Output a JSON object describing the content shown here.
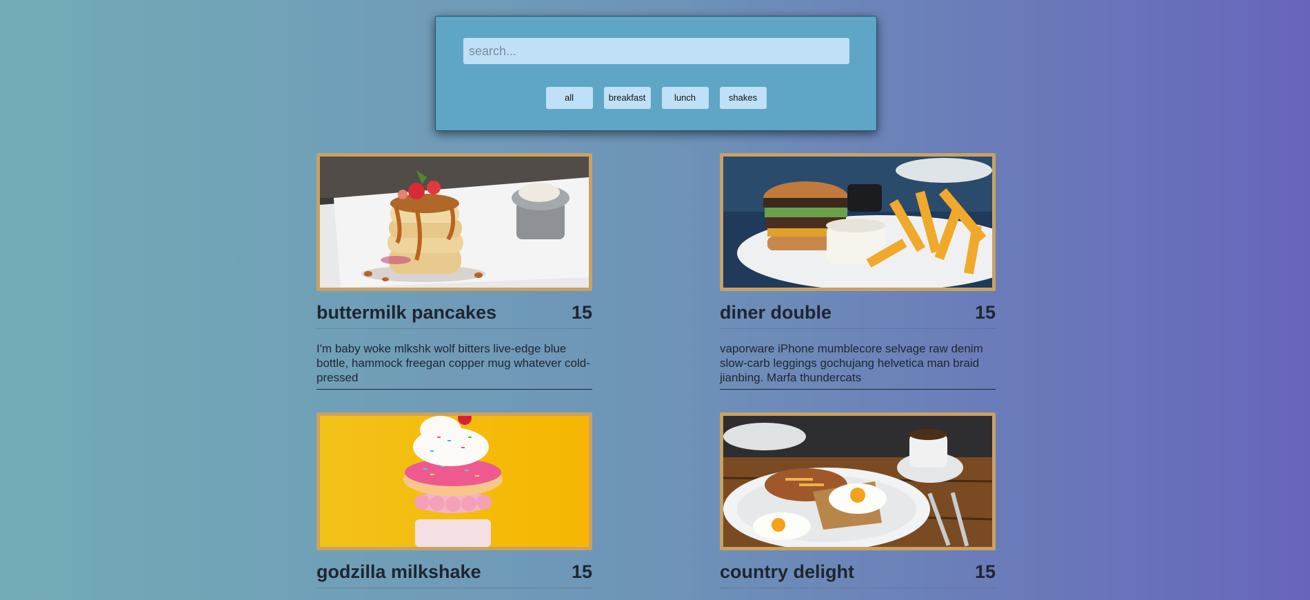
{
  "search": {
    "placeholder": "search..."
  },
  "filters": [
    "all",
    "breakfast",
    "lunch",
    "shakes"
  ],
  "items": [
    {
      "title": "buttermilk pancakes",
      "price": "15",
      "desc": "I'm baby woke mlkshk wolf bitters live-edge blue bottle, hammock freegan copper mug whatever cold-pressed"
    },
    {
      "title": "diner double",
      "price": "15",
      "desc": "vaporware iPhone mumblecore selvage raw denim slow-carb leggings gochujang helvetica man braid jianbing. Marfa thundercats"
    },
    {
      "title": "godzilla milkshake",
      "price": "15",
      "desc": ""
    },
    {
      "title": "country delight",
      "price": "15",
      "desc": ""
    }
  ],
  "colors": {
    "panel": "#5fa6c6",
    "input": "#bfe0f6",
    "frame": "#c8a263"
  }
}
